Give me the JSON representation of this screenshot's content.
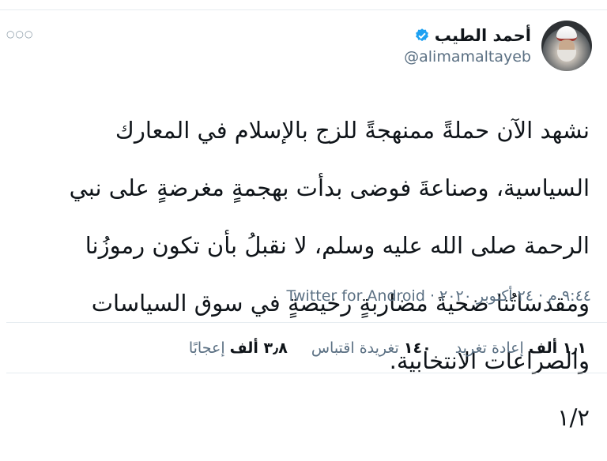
{
  "author": {
    "display_name": "أحمد الطيب",
    "handle": "@alimamaltayeb",
    "verified_color": "#1da1f2"
  },
  "tweet": {
    "text_lines": [
      "نشهد الآن حملةً ممنهجةً للزج بالإسلام في المعارك",
      "السياسية، وصناعةَ فوضى بدأت بهجمةٍ مغرضةٍ على نبي",
      "الرحمة صلى الله عليه وسلم، لا نقبلُ بأن تكون رموزُنا",
      "ومقدساتُنا ضحيةَ مضاربةٍ رخيصةٍ في سوق السياسات",
      "والصراعات الانتخابية.",
      "١/٢"
    ],
    "time": "٩:٤٤ م",
    "date": "٢٤ أكتوبر ٢٠٢٠",
    "separator": "·",
    "source": "Twitter for Android"
  },
  "stats": {
    "retweets_count": "١٫١ ألف",
    "retweets_label": "إعادة تغريد",
    "quotes_count": "١٤٠",
    "quotes_label": "تغريدة اقتباس",
    "likes_count": "٣٫٨ ألف",
    "likes_label": "إعجابًا"
  },
  "icons": {
    "more": "more-icon",
    "verified": "verified-badge-icon"
  }
}
